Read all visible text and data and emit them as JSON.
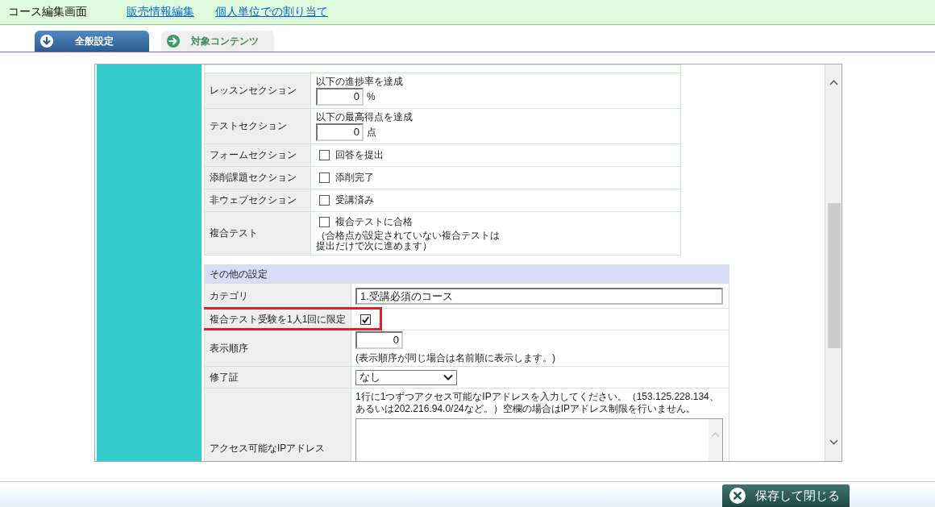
{
  "header": {
    "title": "コース編集画面",
    "links": [
      "販売情報編集",
      "個人単位での割り当て"
    ]
  },
  "tabs": [
    {
      "label": "全般設定",
      "selected": true
    },
    {
      "label": "対象コンテンツ",
      "selected": false
    }
  ],
  "completion_conditions": [
    {
      "kind": "number",
      "label": "レッスンセクション",
      "caption": "以下の進捗率を達成",
      "value": "0",
      "unit": "%"
    },
    {
      "kind": "number",
      "label": "テストセクション",
      "caption": "以下の最高得点を達成",
      "value": "0",
      "unit": "点"
    },
    {
      "kind": "checkbox",
      "label": "フォームセクション",
      "option": "回答を提出",
      "checked": false
    },
    {
      "kind": "checkbox",
      "label": "添削課題セクション",
      "option": "添削完了",
      "checked": false
    },
    {
      "kind": "checkbox",
      "label": "非ウェブセクション",
      "option": "受講済み",
      "checked": false
    },
    {
      "kind": "checkbox",
      "label": "複合テスト",
      "option": "複合テストに合格",
      "checked": false,
      "note": "（合格点が設定されていない複合テストは提出だけで次に進めます）"
    }
  ],
  "other_settings": {
    "title": "その他の設定",
    "rows": [
      {
        "kind": "text",
        "label": "カテゴリ",
        "value": "1.受講必須のコース",
        "highlighted": false
      },
      {
        "kind": "checkbox",
        "label": "複合テスト受験を1人1回に限定",
        "checked": true,
        "highlighted": true
      },
      {
        "kind": "number",
        "label": "表示順序",
        "value": "0",
        "note": "(表示順序が同じ場合は名前順に表示します。)",
        "highlighted": false
      },
      {
        "kind": "select",
        "label": "修了証",
        "value": "なし",
        "highlighted": false
      },
      {
        "kind": "textarea",
        "label": "アクセス可能なIPアドレス",
        "note": "1行に1つずつアクセス可能なIPアドレスを入力してください。（153.125.228.134、あるいは202.216.94.0/24など。）空欄の場合はIPアドレス制限を行いません。",
        "highlighted": false
      }
    ]
  },
  "footer": {
    "button": "保存して閉じる"
  }
}
